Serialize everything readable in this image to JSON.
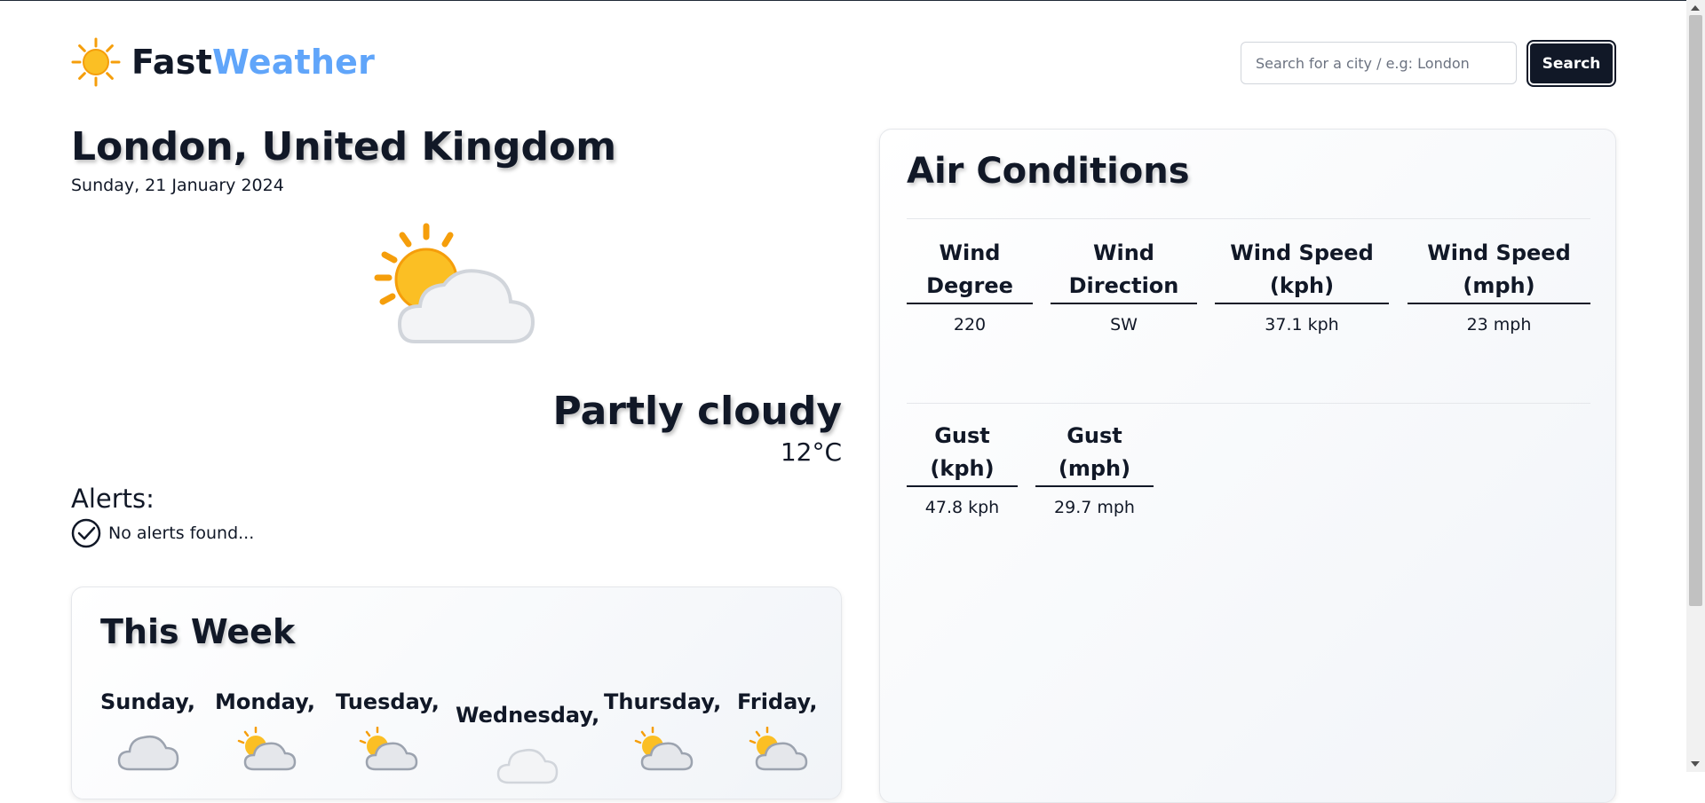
{
  "header": {
    "logo_icon": "sun-icon",
    "logo_part1": "Fast",
    "logo_part2": "Weather",
    "search_placeholder": "Search for a city / e.g: London",
    "search_button": "Search"
  },
  "current": {
    "location": "London, United Kingdom",
    "date": "Sunday, 21 January 2024",
    "icon": "partly-cloudy-icon",
    "condition": "Partly cloudy",
    "temperature": "12°C"
  },
  "alerts": {
    "title": "Alerts:",
    "icon": "check-circle-icon",
    "message": "No alerts found..."
  },
  "week": {
    "title": "This Week",
    "days": [
      {
        "name": "Sunday,",
        "icon": "cloud-icon"
      },
      {
        "name": "Monday,",
        "icon": "partly-cloudy-icon"
      },
      {
        "name": "Tuesday,",
        "icon": "partly-cloudy-icon"
      },
      {
        "name": "Wednesday,",
        "icon": "cloud-icon"
      },
      {
        "name": "Thursday,",
        "icon": "partly-cloudy-icon"
      },
      {
        "name": "Friday,",
        "icon": "partly-cloudy-icon"
      }
    ]
  },
  "air": {
    "title": "Air Conditions",
    "metrics": [
      {
        "label_line1": "Wind",
        "label_line2": "Degree",
        "value": "220"
      },
      {
        "label_line1": "Wind",
        "label_line2": "Direction",
        "value": "SW"
      },
      {
        "label_line1": "Wind Speed",
        "label_line2": "(kph)",
        "value": "37.1 kph"
      },
      {
        "label_line1": "Wind Speed",
        "label_line2": "(mph)",
        "value": "23 mph"
      }
    ],
    "gusts": [
      {
        "label": "Gust (kph)",
        "value": "47.8 kph"
      },
      {
        "label": "Gust (mph)",
        "value": "29.7 mph"
      }
    ]
  },
  "colors": {
    "brand_accent": "#60a5fa",
    "button_bg": "#111827",
    "sun": "#fbbf24",
    "cloud": "#e5e7eb"
  }
}
